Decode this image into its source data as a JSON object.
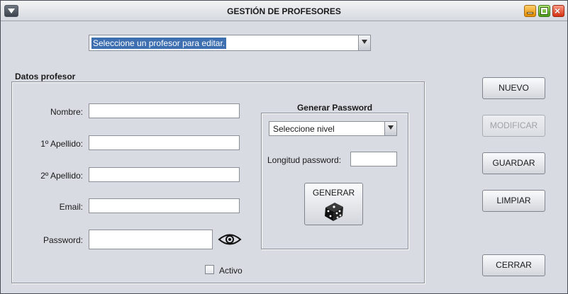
{
  "window": {
    "title": "GESTIÓN DE PROFESORES"
  },
  "profesor_select": {
    "value": "Seleccione un profesor para editar."
  },
  "datos_profesor": {
    "legend": "Datos profesor",
    "fields": {
      "nombre": {
        "label": "Nombre:",
        "value": ""
      },
      "apellido1": {
        "label": "1º Apellido:",
        "value": ""
      },
      "apellido2": {
        "label": "2º Apellido:",
        "value": ""
      },
      "email": {
        "label": "Email:",
        "value": ""
      },
      "password": {
        "label": "Password:",
        "value": ""
      }
    },
    "activo": {
      "label": "Activo",
      "checked": false
    }
  },
  "generar_password": {
    "title": "Generar Password",
    "nivel_select": {
      "value": "Seleccione nivel"
    },
    "longitud": {
      "label": "Longitud password:",
      "value": ""
    },
    "generar_button": "GENERAR"
  },
  "actions": {
    "nuevo": "NUEVO",
    "modificar": "MODIFICAR",
    "guardar": "GUARDAR",
    "limpiar": "LIMPIAR",
    "cerrar": "CERRAR"
  },
  "colors": {
    "background": "#d8dbe2",
    "selection": "#3d6fb1",
    "disabled_text": "#9ea2a9"
  }
}
